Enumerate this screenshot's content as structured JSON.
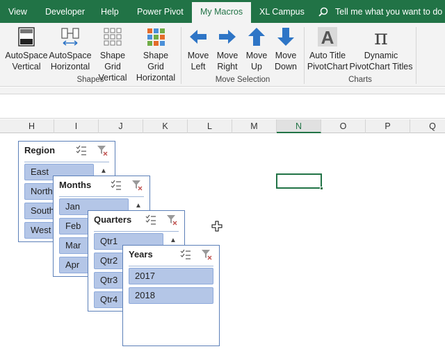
{
  "ribbon_tabs": [
    {
      "label": "View"
    },
    {
      "label": "Developer"
    },
    {
      "label": "Help"
    },
    {
      "label": "Power Pivot"
    },
    {
      "label": "My Macros",
      "active": true
    },
    {
      "label": "XL Campus"
    }
  ],
  "tell_me": {
    "text": "Tell me what you want to do",
    "icon": "lightbulb-search-icon"
  },
  "ribbon": {
    "buttons": [
      {
        "line1": "AutoSpace",
        "line2": "Vertical",
        "icon": "autospace-vertical-icon"
      },
      {
        "line1": "AutoSpace",
        "line2": "Horizontal",
        "icon": "autospace-horizontal-icon"
      },
      {
        "line1": "Shape Grid",
        "line2": "Vertical",
        "icon": "shape-grid-vertical-icon"
      },
      {
        "line1": "Shape Grid",
        "line2": "Horizontal",
        "icon": "shape-grid-horizontal-icon"
      },
      {
        "line1": "Move",
        "line2": "Left",
        "icon": "arrow-left-icon"
      },
      {
        "line1": "Move",
        "line2": "Right",
        "icon": "arrow-right-icon"
      },
      {
        "line1": "Move",
        "line2": "Up",
        "icon": "arrow-up-icon"
      },
      {
        "line1": "Move",
        "line2": "Down",
        "icon": "arrow-down-icon"
      },
      {
        "line1": "Auto Title",
        "line2": "PivotChart",
        "icon": "letter-a-icon"
      },
      {
        "line1": "Dynamic",
        "line2": "PivotChart Titles",
        "icon": "pi-icon"
      }
    ],
    "groups": [
      {
        "label": "Shapes"
      },
      {
        "label": "Move Selection"
      },
      {
        "label": "Charts"
      }
    ]
  },
  "columns": [
    "H",
    "I",
    "J",
    "K",
    "L",
    "M",
    "N",
    "O",
    "P",
    "Q"
  ],
  "selected_column": "N",
  "slicers": [
    {
      "title": "Region",
      "items": [
        "East",
        "North",
        "South",
        "West"
      ]
    },
    {
      "title": "Months",
      "items": [
        "Jan",
        "Feb",
        "Mar",
        "Apr"
      ]
    },
    {
      "title": "Quarters",
      "items": [
        "Qtr1",
        "Qtr2",
        "Qtr3",
        "Qtr4"
      ]
    },
    {
      "title": "Years",
      "items": [
        "2017",
        "2018"
      ]
    }
  ],
  "colors": {
    "accent": "#217346",
    "slicer_item": "#b4c6e7",
    "slicer_border": "#5b7fb8",
    "arrow_blue": "#2e75c6"
  }
}
